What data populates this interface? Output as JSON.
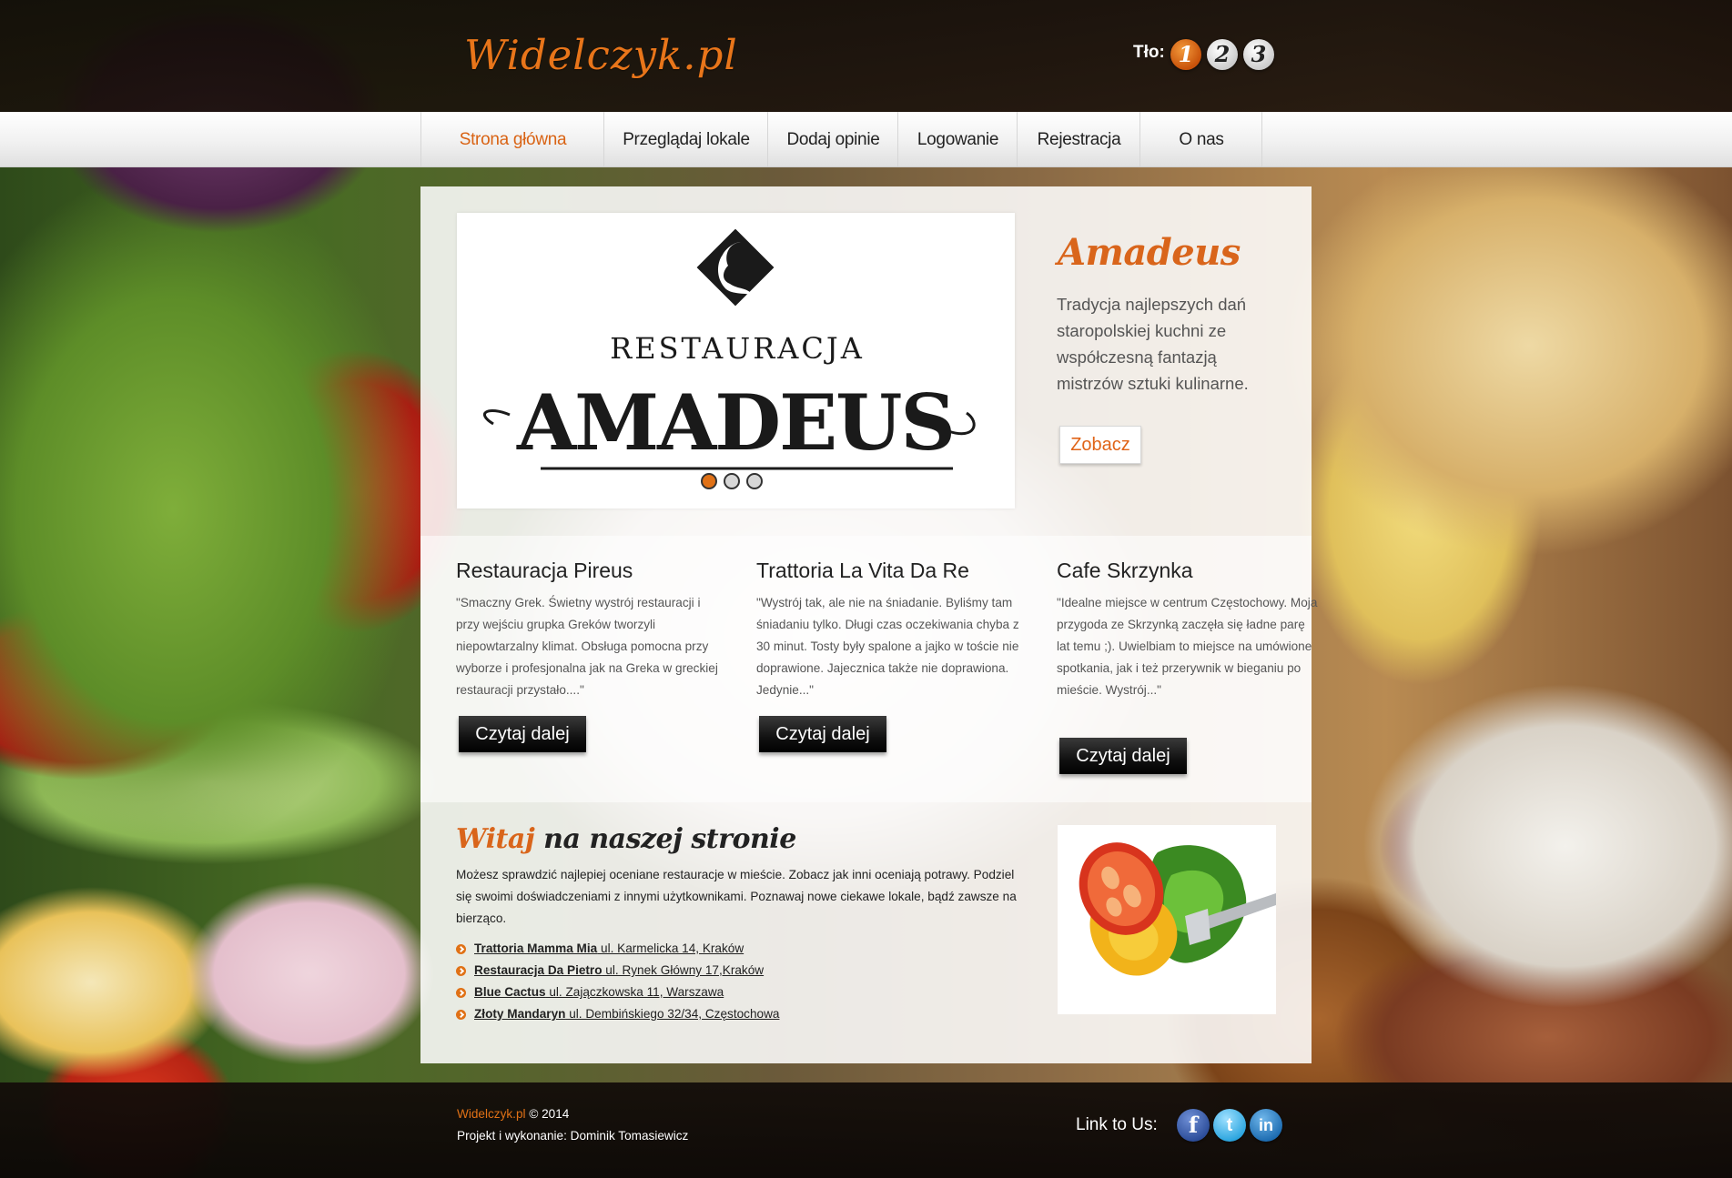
{
  "header": {
    "logo": "Widelczyk.pl",
    "tlo_label": "Tło:",
    "tlo_options": [
      "1",
      "2",
      "3"
    ],
    "tlo_active": "1"
  },
  "nav": {
    "items": [
      {
        "label": "Strona główna",
        "active": true
      },
      {
        "label": "Przeglądaj lokale",
        "active": false
      },
      {
        "label": "Dodaj opinie",
        "active": false
      },
      {
        "label": "Logowanie",
        "active": false
      },
      {
        "label": "Rejestracja",
        "active": false
      },
      {
        "label": "O nas",
        "active": false
      }
    ]
  },
  "slider": {
    "logo_top": "RESTAURACJA",
    "logo_main": "AMADEUS",
    "slide_count": 3,
    "active_slide": 1
  },
  "featured": {
    "title": "Amadeus",
    "description": "Tradycja najlepszych dań staropolskiej kuchni ze współczesną fantazją mistrzów sztuki kulinarne.",
    "button_label": "Zobacz"
  },
  "reviews": [
    {
      "title": "Restauracja Pireus",
      "text": "\"Smaczny Grek. Świetny wystrój restauracji i przy wejściu grupka Greków tworzyli niepowtarzalny klimat. Obsługa pomocna przy wyborze i profesjonalna jak na Greka w greckiej restauracji przystało....\"",
      "button_label": "Czytaj dalej"
    },
    {
      "title": "Trattoria La Vita Da Re",
      "text": "\"Wystrój tak, ale nie na śniadanie. Byliśmy tam śniadaniu tylko. Długi czas oczekiwania chyba z 30 minut. Tosty były spalone a jajko w toście nie doprawione. Jajecznica także nie doprawiona. Jedynie...\"",
      "button_label": "Czytaj dalej"
    },
    {
      "title": "Cafe Skrzynka",
      "text": "\"Idealne miejsce w centrum Częstochowy. Moja przygoda ze Skrzynką zaczęła się ładne parę lat temu ;). Uwielbiam to miejsce na umówione spotkania, jak i też przerywnik w bieganiu po mieście. Wystrój...\"",
      "button_label": "Czytaj dalej"
    }
  ],
  "welcome": {
    "title_accent": "Witaj",
    "title_rest": " na naszej stronie",
    "text": "Możesz sprawdzić najlepiej oceniane restauracje w mieście. Zobacz jak inni oceniają potrawy. Podziel się swoimi doświadczeniami z innymi użytkownikami. Poznawaj nowe ciekawe lokale, bądź zawsze na bierząco.",
    "list": [
      {
        "name": "Trattoria Mamma Mia",
        "address": " ul. Karmelicka 14, Kraków"
      },
      {
        "name": "Restauracja Da Pietro",
        "address": " ul. Rynek Główny 17,Kraków"
      },
      {
        "name": "Blue Cactus",
        "address": " ul. Zajączkowska 11, Warszawa"
      },
      {
        "name": "Złoty Mandaryn",
        "address": " ul. Dembińskiego 32/34, Częstochowa"
      }
    ]
  },
  "footer": {
    "brand": "Widelczyk.pl",
    "copyright": " © 2014",
    "credit": "Projekt i wykonanie: Dominik Tomasiewicz",
    "link_label": "Link to Us:",
    "social": [
      {
        "name": "facebook",
        "glyph": "f"
      },
      {
        "name": "twitter",
        "glyph": "t"
      },
      {
        "name": "linkedin",
        "glyph": "in"
      }
    ]
  },
  "colors": {
    "accent": "#e07116",
    "dark": "#111111"
  }
}
